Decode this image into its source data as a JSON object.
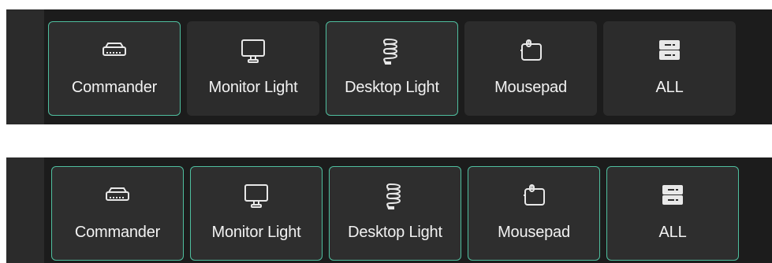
{
  "panels": [
    {
      "id": "top",
      "devices": [
        {
          "label": "Commander",
          "icon": "commander-hub-icon",
          "selected": true
        },
        {
          "label": "Monitor Light",
          "icon": "monitor-icon",
          "selected": false
        },
        {
          "label": "Desktop Light",
          "icon": "light-coil-icon",
          "selected": true
        },
        {
          "label": "Mousepad",
          "icon": "mousepad-icon",
          "selected": false
        },
        {
          "label": "ALL",
          "icon": "server-stack-icon",
          "selected": false
        }
      ]
    },
    {
      "id": "bottom",
      "devices": [
        {
          "label": "Commander",
          "icon": "commander-hub-icon",
          "selected": true
        },
        {
          "label": "Monitor Light",
          "icon": "monitor-icon",
          "selected": true
        },
        {
          "label": "Desktop Light",
          "icon": "light-coil-icon",
          "selected": true
        },
        {
          "label": "Mousepad",
          "icon": "mousepad-icon",
          "selected": true
        },
        {
          "label": "ALL",
          "icon": "server-stack-icon",
          "selected": true
        }
      ]
    }
  ],
  "colors": {
    "panel_bg": "#1c1c1c",
    "tile_bg": "#2c2c2c",
    "selected_border": "#4fbf9f",
    "text": "#f2f2f2"
  }
}
